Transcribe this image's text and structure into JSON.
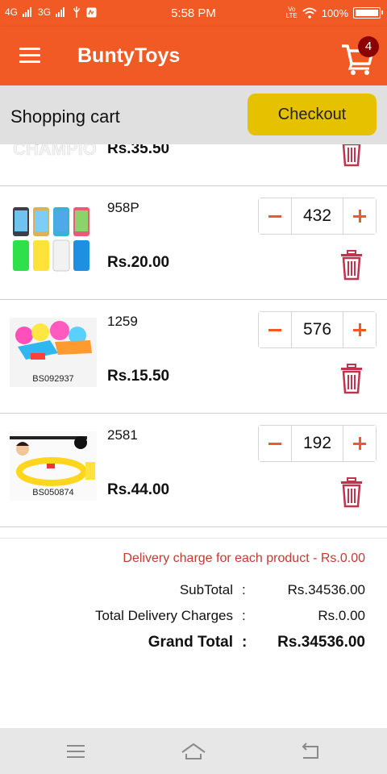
{
  "status_bar": {
    "network_1": "4G",
    "network_2": "3G",
    "time": "5:58 PM",
    "volte": "Vo LTE",
    "battery": "100%"
  },
  "toolbar": {
    "title": "BuntyToys",
    "cart_count": "4"
  },
  "cart_header": {
    "title": "Shopping cart",
    "checkout_label": "Checkout"
  },
  "items": [
    {
      "name": "",
      "price": "Rs.35.50",
      "quantity": "",
      "image_label": ""
    },
    {
      "name": "958P",
      "price": "Rs.20.00",
      "quantity": "432",
      "image_label": ""
    },
    {
      "name": "1259",
      "price": "Rs.15.50",
      "quantity": "576",
      "image_label": "BS092937"
    },
    {
      "name": "2581",
      "price": "Rs.44.00",
      "quantity": "192",
      "image_label": "BS050874"
    }
  ],
  "summary": {
    "delivery_note": "Delivery charge for each product - Rs.0.00",
    "subtotal_label": "SubTotal",
    "subtotal_value": "Rs.34536.00",
    "delivery_label": "Total Delivery Charges",
    "delivery_value": "Rs.0.00",
    "grand_label": "Grand Total",
    "grand_value": "Rs.34536.00",
    "colon": ":"
  },
  "icons": {
    "menu": "menu-icon",
    "cart": "shopping-cart-icon",
    "delete": "trash-icon",
    "minus": "minus-icon",
    "plus": "plus-icon",
    "nav_menu": "nav-menu-icon",
    "nav_home": "home-icon",
    "nav_back": "back-icon"
  },
  "colors": {
    "brand": "#f15a24",
    "checkout": "#e5c100",
    "badge": "#8b0000",
    "delete": "#c2334d",
    "note": "#c23b32"
  }
}
